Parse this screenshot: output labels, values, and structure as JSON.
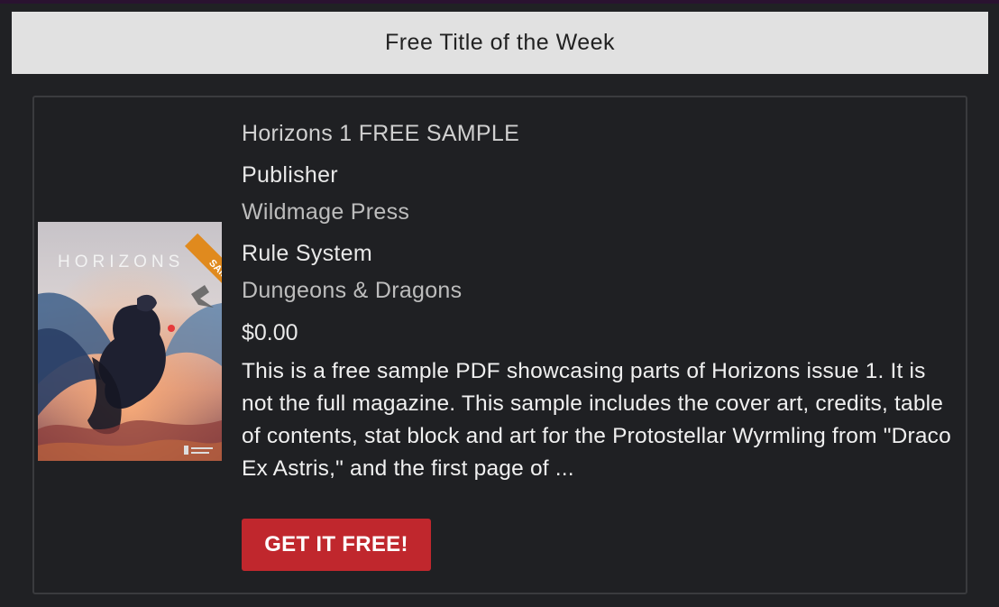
{
  "header": {
    "title": "Free Title of the Week"
  },
  "product": {
    "title": "Horizons 1 FREE SAMPLE",
    "publisher_label": "Publisher",
    "publisher": "Wildmage Press",
    "rule_system_label": "Rule System",
    "rule_system": "Dungeons & Dragons",
    "price": "$0.00",
    "description": "This is a free sample PDF showcasing parts of Horizons issue 1. It is not the full magazine. This sample includes the cover art, credits, table of contents, stat block and art for the Protostellar Wyrmling from \"Draco Ex Astris,\" and the first page of ...",
    "cta_label": "GET IT FREE!",
    "cover": {
      "logo_text": "HORIZONS",
      "ribbon_text": "SAMPLE",
      "ribbon_color": "#e08a1e"
    }
  },
  "colors": {
    "background": "#202124",
    "header_bg": "#e1e1e1",
    "cta_bg": "#c0272d"
  }
}
